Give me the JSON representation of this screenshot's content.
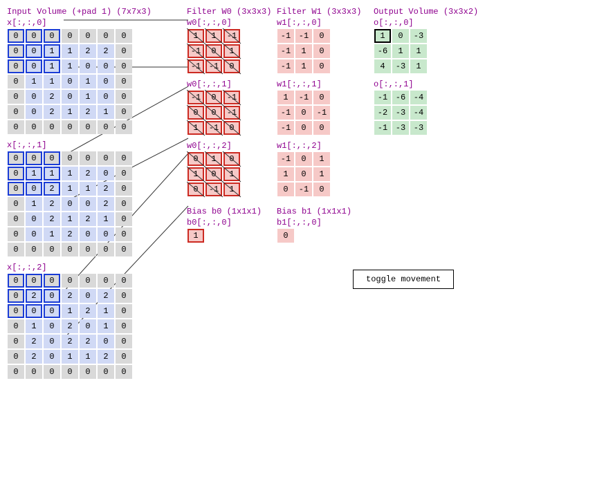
{
  "input": {
    "header": "Input Volume (+pad 1) (7x7x3)",
    "labels": [
      "x[:,:,0]",
      "x[:,:,1]",
      "x[:,:,2]"
    ],
    "slices": [
      [
        [
          0,
          0,
          0,
          0,
          0,
          0,
          0
        ],
        [
          0,
          0,
          1,
          1,
          2,
          2,
          0
        ],
        [
          0,
          0,
          1,
          1,
          0,
          0,
          0
        ],
        [
          0,
          1,
          1,
          0,
          1,
          0,
          0
        ],
        [
          0,
          0,
          2,
          0,
          1,
          0,
          0
        ],
        [
          0,
          0,
          2,
          1,
          2,
          1,
          0
        ],
        [
          0,
          0,
          0,
          0,
          0,
          0,
          0
        ]
      ],
      [
        [
          0,
          0,
          0,
          0,
          0,
          0,
          0
        ],
        [
          0,
          1,
          1,
          1,
          2,
          0,
          0
        ],
        [
          0,
          0,
          2,
          1,
          1,
          2,
          0
        ],
        [
          0,
          1,
          2,
          0,
          0,
          2,
          0
        ],
        [
          0,
          0,
          2,
          1,
          2,
          1,
          0
        ],
        [
          0,
          0,
          1,
          2,
          0,
          0,
          0
        ],
        [
          0,
          0,
          0,
          0,
          0,
          0,
          0
        ]
      ],
      [
        [
          0,
          0,
          0,
          0,
          0,
          0,
          0
        ],
        [
          0,
          2,
          0,
          2,
          0,
          2,
          0
        ],
        [
          0,
          0,
          0,
          1,
          2,
          1,
          0
        ],
        [
          0,
          1,
          0,
          2,
          0,
          1,
          0
        ],
        [
          0,
          2,
          0,
          2,
          2,
          0,
          0
        ],
        [
          0,
          2,
          0,
          1,
          1,
          2,
          0
        ],
        [
          0,
          0,
          0,
          0,
          0,
          0,
          0
        ]
      ]
    ],
    "highlight": {
      "row_start": 0,
      "col_start": 0,
      "size": 3
    }
  },
  "w0": {
    "header": "Filter W0 (3x3x3)",
    "labels": [
      "w0[:,:,0]",
      "w0[:,:,1]",
      "w0[:,:,2]"
    ],
    "slices": [
      [
        [
          1,
          1,
          -1
        ],
        [
          -1,
          0,
          1
        ],
        [
          -1,
          -1,
          0
        ]
      ],
      [
        [
          -1,
          0,
          -1
        ],
        [
          0,
          0,
          -1
        ],
        [
          1,
          -1,
          0
        ]
      ],
      [
        [
          0,
          1,
          0
        ],
        [
          1,
          0,
          1
        ],
        [
          0,
          -1,
          1
        ]
      ]
    ]
  },
  "w1": {
    "header": "Filter W1 (3x3x3)",
    "labels": [
      "w1[:,:,0]",
      "w1[:,:,1]",
      "w1[:,:,2]"
    ],
    "slices": [
      [
        [
          -1,
          -1,
          0
        ],
        [
          -1,
          1,
          0
        ],
        [
          -1,
          1,
          0
        ]
      ],
      [
        [
          1,
          -1,
          0
        ],
        [
          -1,
          0,
          -1
        ],
        [
          -1,
          0,
          0
        ]
      ],
      [
        [
          -1,
          0,
          1
        ],
        [
          1,
          0,
          1
        ],
        [
          0,
          -1,
          0
        ]
      ]
    ]
  },
  "out": {
    "header": "Output Volume (3x3x2)",
    "labels": [
      "o[:,:,0]",
      "o[:,:,1]"
    ],
    "slices": [
      [
        [
          1,
          0,
          -3
        ],
        [
          -6,
          1,
          1
        ],
        [
          4,
          -3,
          1
        ]
      ],
      [
        [
          -1,
          -6,
          -4
        ],
        [
          -2,
          -3,
          -4
        ],
        [
          -1,
          -3,
          -3
        ]
      ]
    ],
    "highlight": {
      "slice": 0,
      "row": 0,
      "col": 0
    }
  },
  "bias": {
    "b0": {
      "header": "Bias b0 (1x1x1)",
      "label": "b0[:,:,0]",
      "value": 1
    },
    "b1": {
      "header": "Bias b1 (1x1x1)",
      "label": "b1[:,:,0]",
      "value": 0
    }
  },
  "button": {
    "label": "toggle movement"
  }
}
